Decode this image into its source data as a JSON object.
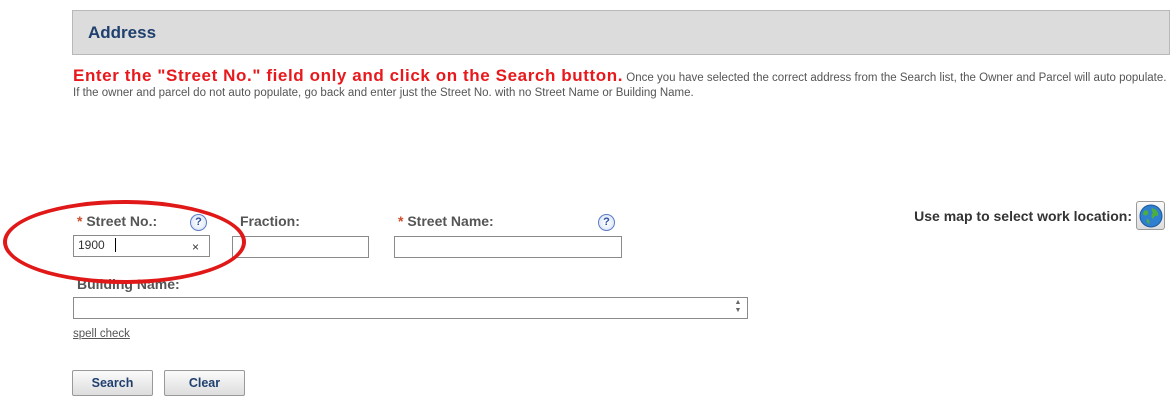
{
  "section": {
    "title": "Address"
  },
  "instructions": {
    "warning": "Enter the \"Street No.\" field only and click on the Search button.",
    "detail": "Once you have selected the correct address from the Search list, the Owner and Parcel will auto populate.  If the owner and parcel do not auto populate, go back and enter just the Street No. with no Street Name or Building Name."
  },
  "map": {
    "label": "Use map to select work location:",
    "icon": "globe-icon"
  },
  "fields": {
    "required_mark": "*",
    "street_no": {
      "label": "Street No.:",
      "value": "1900",
      "clear": "×"
    },
    "fraction": {
      "label": "Fraction:",
      "value": ""
    },
    "street_name": {
      "label": "Street Name:",
      "value": ""
    },
    "building_name": {
      "label": "Building Name:",
      "value": ""
    },
    "help_icon": "?"
  },
  "spell_check": "spell check",
  "buttons": {
    "search": "Search",
    "clear": "Clear"
  },
  "colors": {
    "warning": "#e8191c",
    "header_bg": "#dcdcdc",
    "annotation": "#e01818"
  }
}
